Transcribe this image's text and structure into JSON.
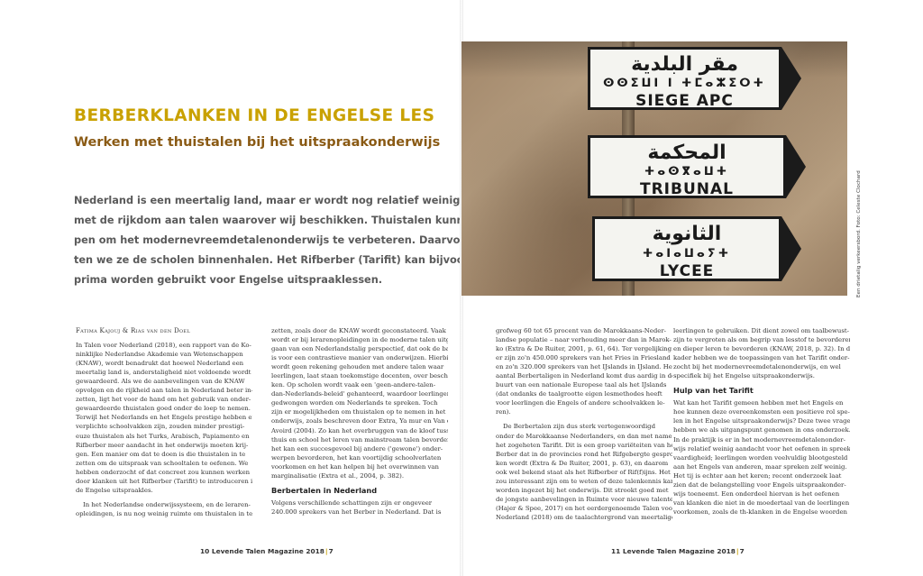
{
  "left_page": {
    "title": "BERBERKLANKEN IN DE ENGELSE LES",
    "subtitle": "Werken met thuistalen bij het uitspraakonderwijs",
    "intro_lines": [
      "Nederland is een meertalig land, maar er wordt nog relatief weinig gedaan",
      "met de rijkdom aan talen waarover wij beschikken. Thuistalen kunnen hel-",
      "pen om het modernevreemdetalenonderwijs te verbeteren. Daarvoor moe-",
      "ten we ze de scholen binnenhalen. Het Rifberber (Tarifit) kan bijvoorbeeld",
      "prima worden gebruikt voor Engelse uitspraaklessen."
    ],
    "authors": "Fatima Kajouj & Rias van den Doel",
    "col1_lines": [
      "In Talen voor Nederland (2018), een rapport van de Ko-",
      "ninklijke Nederlandse Akademie van Wetenschappen",
      "(KNAW), wordt benadrukt dat hoewel Nederland een",
      "meertalig land is, anderstaligheid niet voldoende wordt",
      "gewaardeerd. Als we de aanbevelingen van de KNAW",
      "opvolgen en de rijkheid aan talen in Nederland beter in-",
      "zetten, ligt het voor de hand om het gebruik van onder-",
      "gewaardeerde thuistalen goed onder de loep te nemen.",
      "Terwijl het Nederlands en het Engels prestige hebben en",
      "verplichte schoolvakken zijn, zouden minder prestigi-",
      "euze thuistalen als het Turks, Arabisch, Papiamento en",
      "Rifberber meer aandacht in het onderwijs moeten krij-",
      "gen. Een manier om dat te doen is die thuistalen in te",
      "zetten om de uitspraak van schooltalen te oefenen. We",
      "hebben onderzocht of dat concreet zou kunnen werken",
      "door klanken uit het Rifberber (Tarifit) te introduceren in",
      "de Engelse uitspraakles.",
      "In het Nederlandse onderwijssysteem, en de leraren-",
      "opleidingen, is nu nog weinig ruimte om thuistalen in te"
    ],
    "col2_lines": [
      "zetten, zoals door de KNAW wordt geconstateerd. Vaak",
      "wordt er bij lerarenopleidingen in de moderne talen uitge-",
      "gaan van een Nederlandstalig perspectief, dat ook de basis",
      "is voor een contrastieve manier van onderwijzen. Hierbij",
      "wordt geen rekening gehouden met andere talen waar",
      "leerlingen, laat staan toekomstige docenten, over beschik-",
      "ken. Op scholen wordt vaak een 'geen-andere-talen-",
      "dan-Nederlands-beleid' gehanteerd, waardoor leerlingen",
      "gedwongen worden om Nederlands te spreken. Toch",
      "zijn er mogelijkheden om thuistalen op te nemen in het",
      "onderwijs, zoals beschreven door Extra, Ya mur en Van der",
      "Avoird (2004). Zo kan het overbruggen van de kloof tussen",
      "thuis en school het leren van mainstream talen bevorderen,",
      "het kan een succesgevoel bij andere ('gewone') onder-",
      "werpen bevorderen, het kan voortijdig schoolverlaten",
      "voorkomen en het kan helpen bij het overwinnen van",
      "marginalisatie (Extra et al., 2004, p. 382)."
    ],
    "col2_heading": "Berbertalen in Nederland",
    "col2_after_lines": [
      "Volgens verschillende schattingen zijn er ongeveer",
      "240.000 sprekers van het Berber in Nederland. Dat is"
    ],
    "footer_page": "10",
    "footer_mag": "Levende Talen Magazine 2018",
    "footer_sep": "|",
    "footer_issue": "7"
  },
  "right_page": {
    "photo": {
      "sign1_arabic": "مقر البلدية",
      "sign1_tifinagh": "ⵙⵙⵉⵡⵏ ⵏ ⵜⵎⴰⵣⵉⵔⵜ",
      "sign1_latin": "SIEGE APC",
      "sign2_arabic": "المحكمة",
      "sign2_tifinagh": "ⵜⴰⵙⴳⴰⵡⵜ",
      "sign2_latin": "TRIBUNAL",
      "sign3_arabic": "الثانوية",
      "sign3_tifinagh": "ⵜⴰⵏⴰⵡⴰⵢⵜ",
      "sign3_latin": "LYCEE",
      "credit": "Een drietalig verkeersbord. Foto: Celeste Clochard"
    },
    "col3_lines": [
      "grofweg 60 tot 65 procent van de Marokkaans-Neder-",
      "landse populatie – naar verhouding meer dan in Marok-",
      "ko (Extra & De Ruiter, 2001, p. 61, 64). Ter vergelijking:",
      "er zijn zo'n 450.000 sprekers van het Fries in Friesland",
      "en zo'n 320.000 sprekers van het IJslands in IJsland. Het",
      "aantal Berbertaligen in Nederland komt dus aardig in de",
      "buurt van een nationale Europese taal als het IJslands",
      "(dat ondanks de taalgrootte eigen lesmethodes heeft",
      "voor leerlingen die Engels of andere schoolvakken le-",
      "ren).",
      "De Berbertalen zijn dus sterk vertegenwoordigd",
      "onder de Marokkaanse Nederlanders, en dan met name",
      "het zogeheten Tarifit. Dit is een groep variëteiten van het",
      "Berber dat in de provincies rond het Rifgebergte gespro-",
      "ken wordt (Extra & De Ruiter, 2001, p. 63), en daarom",
      "ook wel bekend staat als het Rifberber of Rif(f)ijns. Het",
      "zou interessant zijn om te weten of deze talenkennis kan",
      "worden ingezet bij het onderwijs. Dit strookt goed met",
      "de jongste aanbevelingen in Ruimte voor nieuwe talenten",
      "(Hajer & Spee, 2017) en het eerdergenoemde Talen voor",
      "Nederland (2018) om de taalachtergrond van meertalige"
    ],
    "col4_lines": [
      "leerlingen te gebruiken. Dit dient zowel om taalbewust-",
      "zijn te vergroten als om begrip van lesstof te bevorderen",
      "en dieper leren te bevorderen (KNAW, 2018, p. 32). In dit",
      "kader hebben we de toepassingen van het Tarifit onder-",
      "zocht bij het modernevreemdetalenonderwijs, en wel",
      "specifiek bij het Engelse uitspraakonderwijs."
    ],
    "col4_heading": "Hulp van het Tarifit",
    "col4_after_lines": [
      "Wat kan het Tarifit gemeen hebben met het Engels en",
      "hoe kunnen deze overeenkomsten een positieve rol spe-",
      "len in het Engelse uitspraakonderwijs? Deze twee vragen",
      "hebben we als uitgangspunt genomen in ons onderzoek.",
      "In de praktijk is er in het modernevreemdetalenonder-",
      "wijs relatief weinig aandacht voor het oefenen in spreek-",
      "vaardigheid; leerlingen worden veelvuldig blootgesteld",
      "aan het Engels van anderen, maar spreken zelf weinig.",
      "Het tij is echter aan het keren; recent onderzoek laat",
      "zien dat de belangstelling voor Engels uitspraakonder-",
      "wijs toeneemt. Een onderdeel hiervan is het oefenen",
      "van klanken die niet in de moedertaal van de leerlingen",
      "voorkomen, zoals de th-klanken in de Engelse woorden"
    ],
    "footer_page": "11",
    "footer_mag": "Levende Talen Magazine 2018",
    "footer_sep": "|",
    "footer_issue": "7"
  },
  "colors": {
    "title": "#c9a100",
    "subtitle": "#8a5a14",
    "intro": "#5a5a5a"
  }
}
